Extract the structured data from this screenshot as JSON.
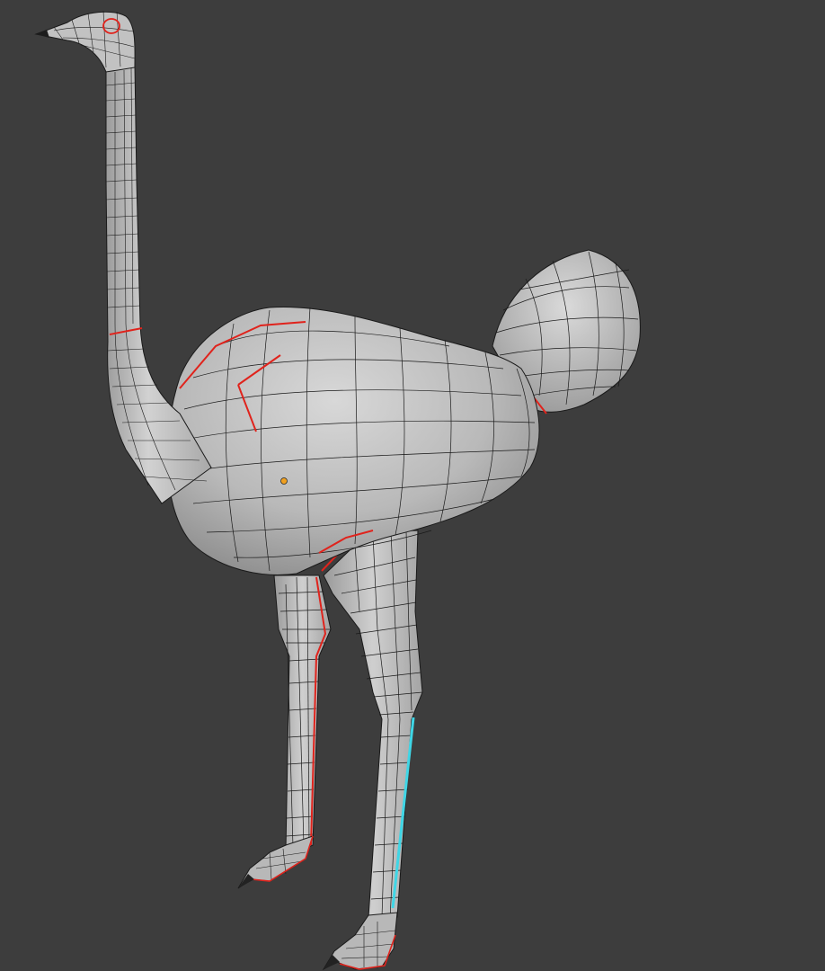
{
  "viewport": {
    "background_color": "#3d3d3d",
    "mode": "edit-mode-wireframe-on-shaded"
  },
  "mesh": {
    "object_name_visible": false,
    "subject": "ostrich",
    "face_color": "#bdbdbd",
    "wire_color": "#1a1a1a",
    "seam_color": "#e0231c",
    "active_edge_color": "#3fd6e6",
    "origin_color": "#f0a020"
  }
}
